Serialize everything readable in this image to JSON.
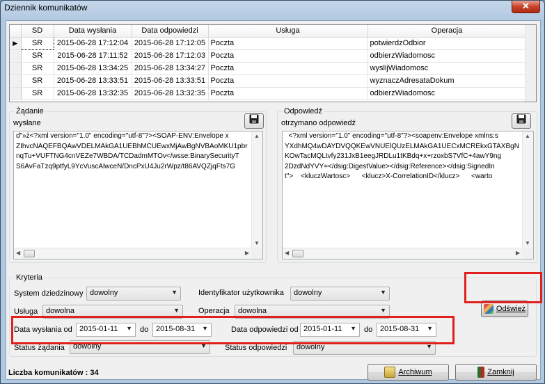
{
  "window": {
    "title": "Dziennik komunikatów",
    "close_glyph": "✕"
  },
  "grid": {
    "columns": [
      "SD",
      "Data wysłania",
      "Data odpowiedzi",
      "Usługa",
      "Operacja"
    ],
    "rows": [
      {
        "sd": "SR",
        "sent": "2015-06-28 17:12:04",
        "resp": "2015-06-28 17:12:05",
        "service": "Poczta",
        "op": "potwierdzOdbior",
        "current": true
      },
      {
        "sd": "SR",
        "sent": "2015-06-28 17:11:52",
        "resp": "2015-06-28 17:12:03",
        "service": "Poczta",
        "op": "odbierzWiadomosc"
      },
      {
        "sd": "SR",
        "sent": "2015-06-28 13:34:25",
        "resp": "2015-06-28 13:34:27",
        "service": "Poczta",
        "op": "wyslijWiadomosc"
      },
      {
        "sd": "SR",
        "sent": "2015-06-28 13:33:51",
        "resp": "2015-06-28 13:33:51",
        "service": "Poczta",
        "op": "wyznaczAdresataDokum"
      },
      {
        "sd": "SR",
        "sent": "2015-06-28 13:32:35",
        "resp": "2015-06-28 13:32:35",
        "service": "Poczta",
        "op": "odbierzWiadomosc"
      }
    ],
    "row_indicator_icon": "current-row-arrow-icon"
  },
  "request": {
    "group_label": "Żądanie",
    "sub_label": "wysłane",
    "save_icon": "save-disk-icon",
    "lines": [
      "d\"»ż<?xml version=\"1.0\" encoding=\"utf-8\"?><SOAP-ENV:Envelope x",
      "ZIhvcNAQEFBQAwVDELMAkGA1UEBhMCUEwxMjAwBgNVBAoMKU1pbr",
      "nqTu+VUFTNG4cnVEZe7WBDA/TCDadmMTOv</wsse:BinarySecurityT",
      "S6AvFaTzq9ptfyL9YcVuscAlwceN/DncPxU4Ju2rWpz/t86AVQZjqFts7G"
    ]
  },
  "response": {
    "group_label": "Odpowiedź",
    "sub_label": "otrzymano odpowiedź",
    "save_icon": "save-disk-icon",
    "lines": [
      "  <?xml version=\"1.0\" encoding=\"utf-8\"?><soapenv:Envelope xmlns:s",
      "YXdhMQ4wDAYDVQQKEwVNUElQUzELMAkGA1UECxMCREkxGTAXBgN",
      "KOwTacMQLtvfy231JxB1eegJRDLu1tKBdq+x+rzoxbS7VfC+4awY9ng",
      "2DzdNdYVY=</dsig:DigestValue></dsig:Reference></dsig:SignedIn",
      "t\">    <kluczWartosc>      <klucz>X-CorrelationID</klucz>      <warto"
    ]
  },
  "criteria": {
    "group_label": "Kryteria",
    "system_label": "System dziedzinowy",
    "system_value": "dowolny",
    "user_label": "Identyfikator użytkownika",
    "user_value": "dowolny",
    "service_label": "Usługa",
    "service_value": "dowolna",
    "operation_label": "Operacja",
    "operation_value": "dowolna",
    "sent_from_label": "Data wysłania od",
    "sent_from_value": "2015-01-11",
    "sent_to_label": "do",
    "sent_to_value": "2015-08-31",
    "resp_from_label": "Data odpowiedzi od",
    "resp_from_value": "2015-01-11",
    "resp_to_label": "do",
    "resp_to_value": "2015-08-31",
    "req_status_label": "Status żądania",
    "req_status_value": "dowolny",
    "resp_status_label": "Status odpowiedzi",
    "resp_status_value": "dowolny",
    "refresh_label": "Odśwież",
    "refresh_icon": "refresh-icon"
  },
  "footer": {
    "count_text": "Liczba komunikatów : 34",
    "archive_label": "Archiwum",
    "archive_icon": "archive-icon",
    "close_label": "Zamknij",
    "close_icon": "exit-door-icon"
  },
  "colors": {
    "highlight": "#e0201c"
  }
}
